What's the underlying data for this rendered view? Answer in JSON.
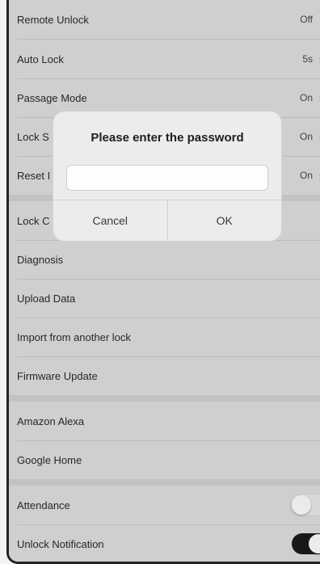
{
  "settings": [
    {
      "label": "Remote Unlock",
      "value": "Off",
      "chevron": false
    },
    {
      "label": "Auto Lock",
      "value": "5s",
      "chevron": true
    },
    {
      "label": "Passage Mode",
      "value": "On",
      "chevron": true
    },
    {
      "label": "Lock S",
      "value": "On",
      "chevron": true
    },
    {
      "label": "Reset I",
      "value": "On",
      "chevron": true
    },
    {
      "label": "Lock C",
      "value": "",
      "chevron": false
    },
    {
      "label": "Diagnosis",
      "value": "",
      "chevron": false
    },
    {
      "label": "Upload Data",
      "value": "",
      "chevron": false
    },
    {
      "label": "Import from another lock",
      "value": "",
      "chevron": false
    },
    {
      "label": "Firmware Update",
      "value": "",
      "chevron": false
    },
    {
      "label": "Amazon Alexa",
      "value": "",
      "chevron": false
    },
    {
      "label": "Google Home",
      "value": "",
      "chevron": false
    }
  ],
  "toggles": [
    {
      "label": "Attendance",
      "state": "off"
    },
    {
      "label": "Unlock Notification",
      "state": "on"
    }
  ],
  "dialog": {
    "title": "Please enter the password",
    "password_value": "",
    "cancel_label": "Cancel",
    "ok_label": "OK"
  },
  "icons": {
    "chevron": "chevron-right-icon"
  }
}
